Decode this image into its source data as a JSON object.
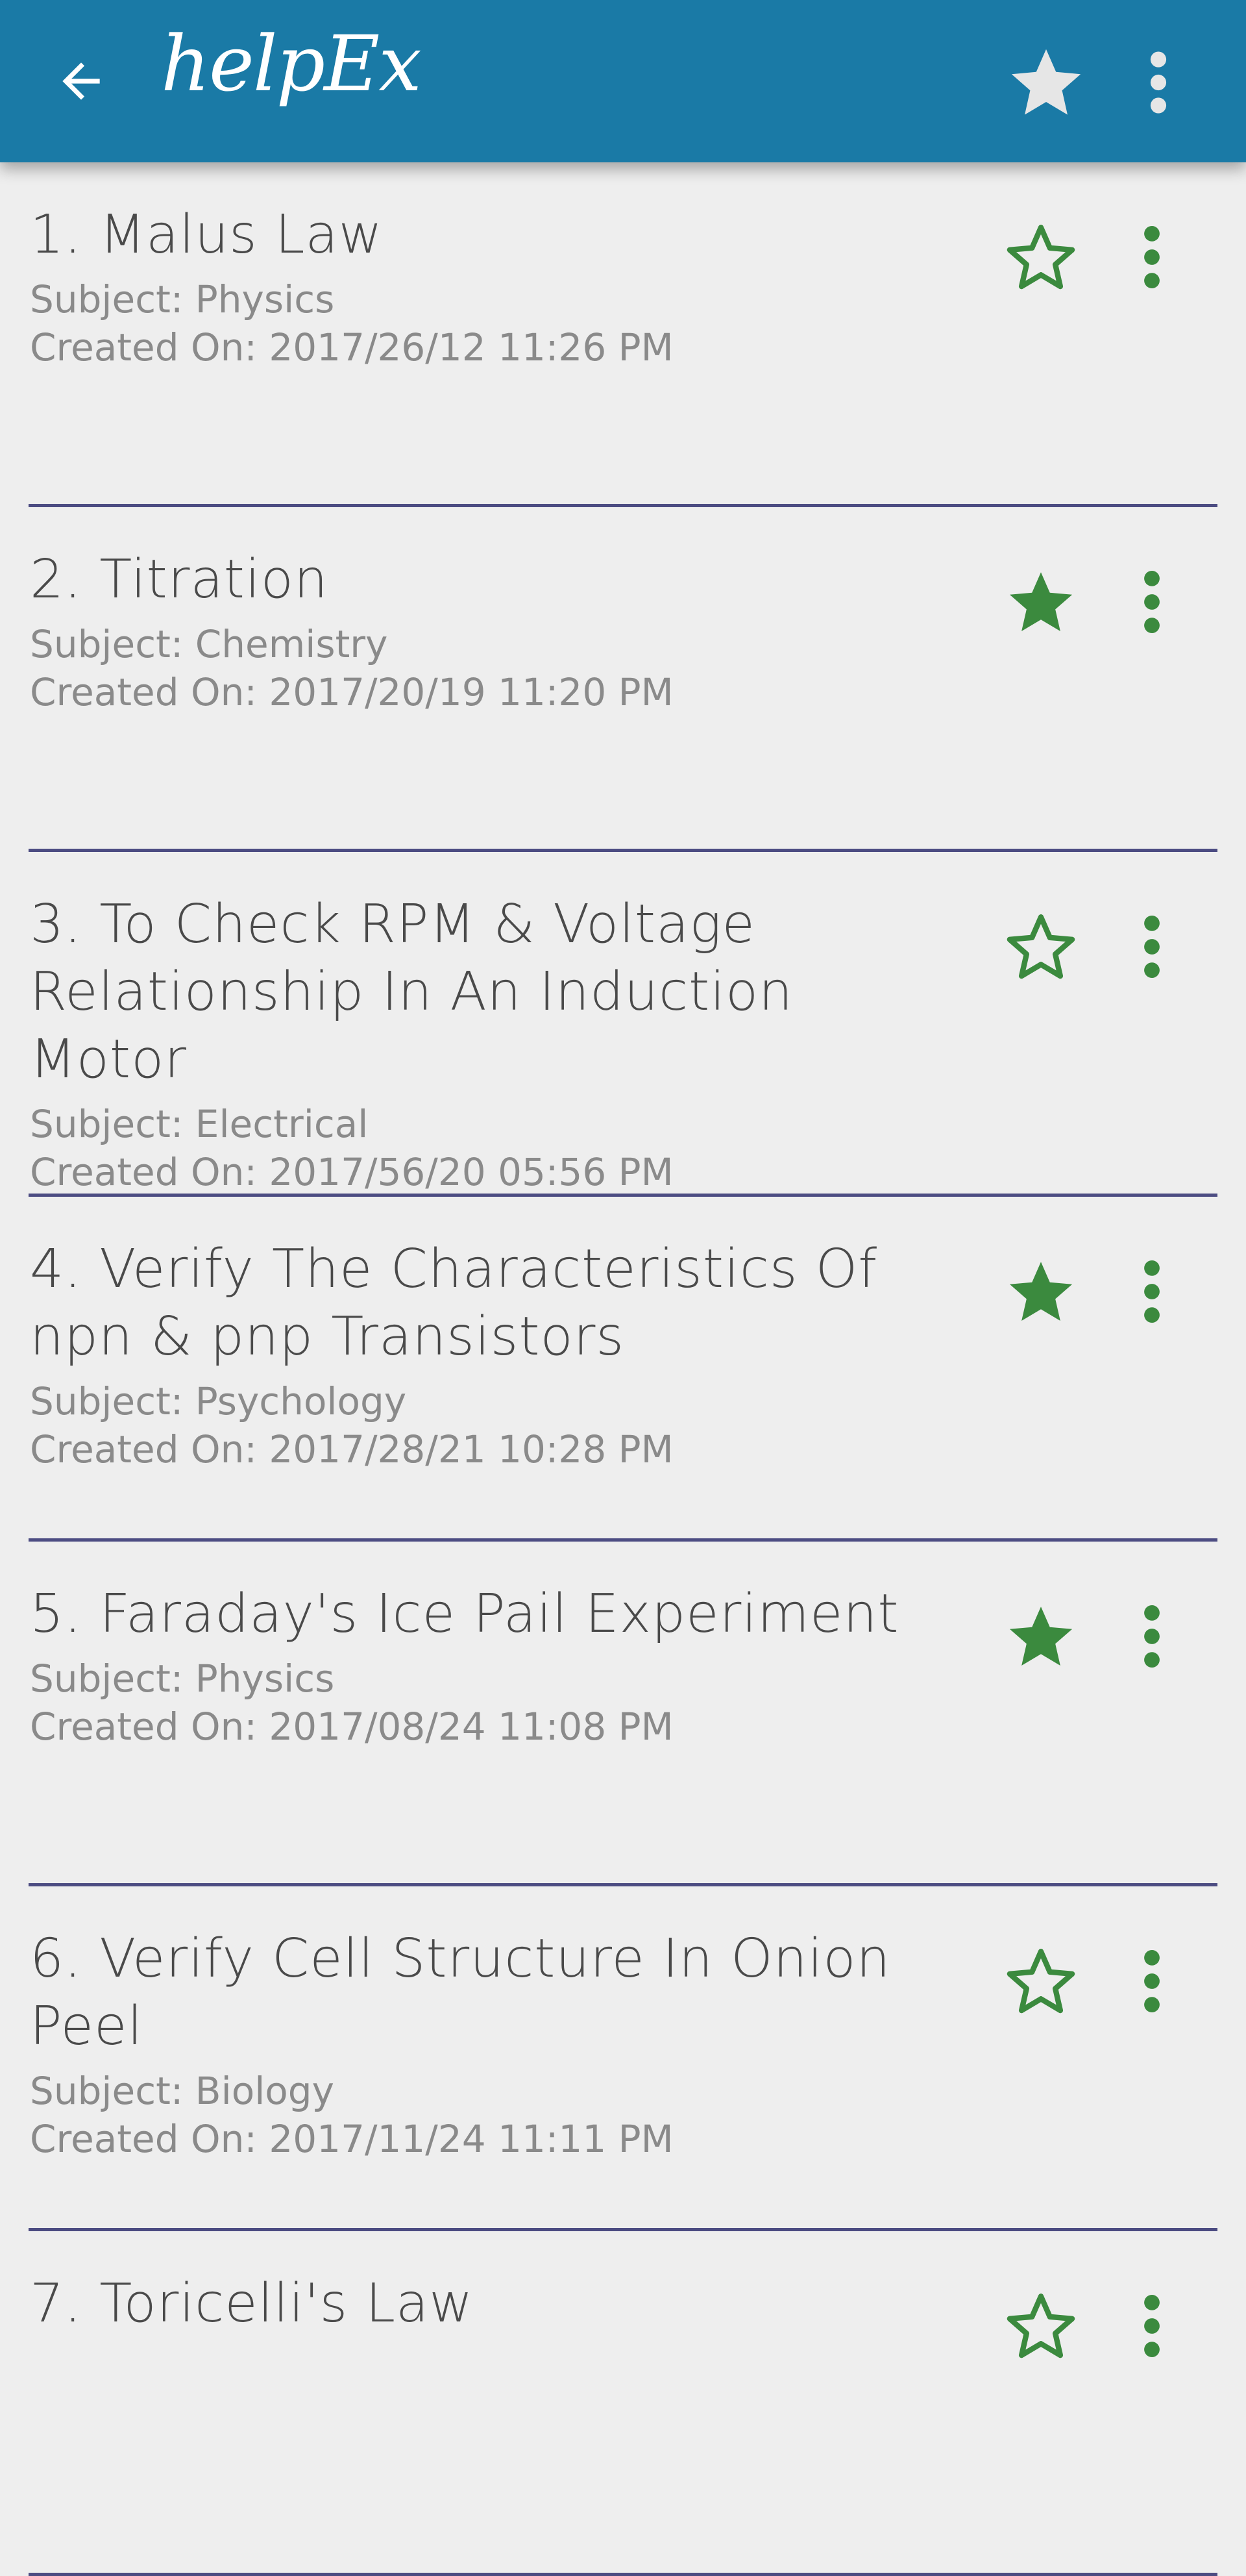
{
  "app_bar": {
    "title": "helpEx",
    "back_icon": "arrow-back-icon",
    "favorite_icon": "star-filled-icon",
    "overflow_icon": "more-vertical-icon",
    "background_color": "#1a7aa6"
  },
  "colors": {
    "accent_green": "#3b8a3e",
    "divider": "#4c4c82",
    "title_text": "#4a4a4a",
    "secondary_text": "#8a8a8a",
    "background": "#eeeeee"
  },
  "experiments": [
    {
      "title": "1. Malus Law",
      "subject": "Subject: Physics",
      "created": "Created On: 2017/26/12  11:26 PM",
      "starred": false
    },
    {
      "title": "2. Titration",
      "subject": "Subject: Chemistry",
      "created": "Created On: 2017/20/19  11:20 PM",
      "starred": true
    },
    {
      "title": "3. To Check RPM & Voltage Relationship In An Induction Motor",
      "subject": "Subject: Electrical",
      "created": "Created On: 2017/56/20  05:56 PM",
      "starred": false
    },
    {
      "title": "4. Verify The Characteristics Of npn & pnp Transistors",
      "subject": "Subject: Psychology",
      "created": "Created On: 2017/28/21  10:28 PM",
      "starred": true
    },
    {
      "title": "5. Faraday's Ice Pail Experiment",
      "subject": "Subject: Physics",
      "created": "Created On: 2017/08/24  11:08 PM",
      "starred": true
    },
    {
      "title": "6. Verify Cell Structure In Onion Peel",
      "subject": "Subject: Biology",
      "created": "Created On: 2017/11/24  11:11 PM",
      "starred": false
    },
    {
      "title": "7. Toricelli's Law",
      "subject": "",
      "created": "",
      "starred": false
    }
  ]
}
